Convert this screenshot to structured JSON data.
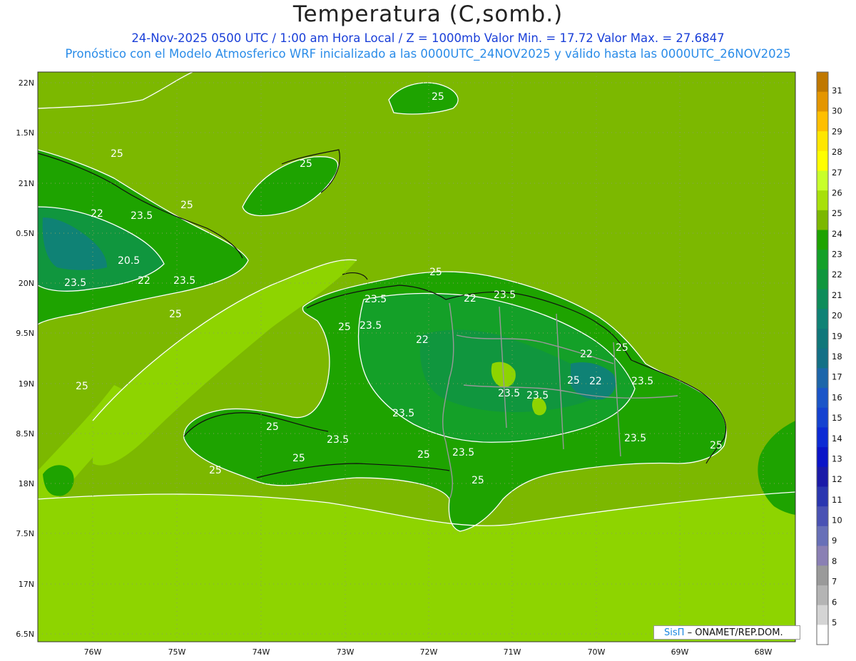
{
  "header": {
    "title": "Temperatura (C,somb.)",
    "subtitle_1": "24-Nov-2025  0500 UTC / 1:00 am Hora Local / Z = 1000mb     Valor Min. = 17.72  Valor Max. = 27.6847",
    "subtitle_2": "Pronóstico con el Modelo Atmosferico WRF inicializado a las 0000UTC_24NOV2025 y válido hasta las  0000UTC_26NOV2025"
  },
  "map": {
    "lat_ticks": [
      "22N",
      "1.5N",
      "21N",
      "0.5N",
      "20N",
      "9.5N",
      "19N",
      "8.5N",
      "18N",
      "7.5N",
      "17N",
      "6.5N"
    ],
    "lon_ticks": [
      "76W",
      "75W",
      "74W",
      "73W",
      "72W",
      "71W",
      "70W",
      "69W",
      "68W"
    ],
    "contour_labels": [
      "25",
      "25",
      "25",
      "25",
      "22",
      "23.5",
      "20.5",
      "22",
      "23.5",
      "23.5",
      "25",
      "25",
      "25",
      "23.5",
      "22",
      "23.5",
      "25",
      "25",
      "23.5",
      "22",
      "22",
      "25",
      "22",
      "23.5",
      "23.5",
      "23.5",
      "23.5",
      "25",
      "23.5",
      "25",
      "25",
      "23.5",
      "23.5",
      "25",
      "25",
      "25"
    ],
    "colors": {
      "sea_25_26": "#8ed400",
      "sea_24_25": "#7cb800",
      "land_24": "#1ea300",
      "land_23": "#14a028",
      "land_22": "#10963e",
      "land_21": "#0e8c5a",
      "land_20": "#0f8275",
      "land_26": "#8ed400",
      "coast": "#111111",
      "border": "#999999",
      "contour": "#ffffff"
    }
  },
  "colorbar": {
    "labels": [
      "31",
      "30",
      "29",
      "28",
      "27",
      "26",
      "25",
      "24",
      "23",
      "22",
      "21",
      "20",
      "19",
      "18",
      "17",
      "16",
      "15",
      "14",
      "13",
      "12",
      "11",
      "10",
      "9",
      "8",
      "7",
      "6",
      "5"
    ],
    "colors": [
      "#c07800",
      "#e49600",
      "#ffbf00",
      "#ffe600",
      "#fffe00",
      "#c8ff2a",
      "#a8e00a",
      "#7cb800",
      "#1ea300",
      "#14a028",
      "#10963e",
      "#0e8c5a",
      "#0f8275",
      "#10777a",
      "#137086",
      "#1c66aa",
      "#1a55c8",
      "#1442d0",
      "#0c2ad4",
      "#0a14c8",
      "#1a1aa8",
      "#2a36b0",
      "#4a52b4",
      "#6870b8",
      "#8a80b4",
      "#9a9a9a",
      "#b4b4b4",
      "#d4d4d4",
      "#ffffff"
    ]
  },
  "credit": {
    "brand": "SisΠ",
    "text": "– ONAMET/REP.DOM."
  }
}
